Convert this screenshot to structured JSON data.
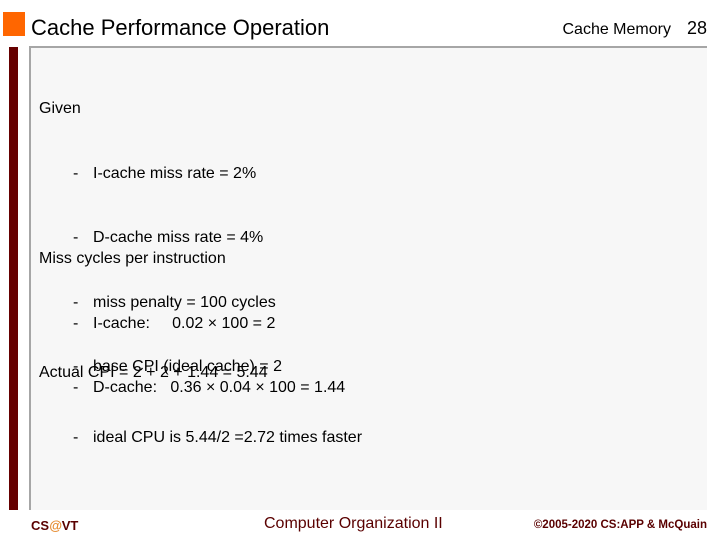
{
  "header": {
    "title": "Cache Performance Operation",
    "section_name": "Cache Memory",
    "page_number": "28"
  },
  "content": {
    "given": {
      "heading": "Given",
      "items": [
        "I-cache miss rate = 2%",
        "D-cache miss rate = 4%",
        "miss penalty = 100 cycles",
        "base CPI (ideal cache) = 2"
      ]
    },
    "miss_cycles": {
      "heading": "Miss cycles per instruction",
      "items": [
        "I-cache:     0.02 × 100 = 2",
        "D-cache:   0.36 × 0.04 × 100 = 1.44"
      ]
    },
    "actual_cpi": {
      "heading": "Actual CPI = 2 + 2 + 1.44 = 5.44",
      "items": [
        "ideal CPU is 5.44/2 =2.72 times faster"
      ]
    },
    "bullet": "-"
  },
  "footer": {
    "left_prefix": "CS",
    "left_at": "@",
    "left_suffix": "VT",
    "center": "Computer Organization II",
    "right": "©2005-2020 CS:APP & McQuain"
  },
  "colors": {
    "accent_orange": "#ff6600",
    "maroon": "#660000",
    "footer_text": "#5a0000",
    "panel_bg": "#f7f7f7"
  }
}
